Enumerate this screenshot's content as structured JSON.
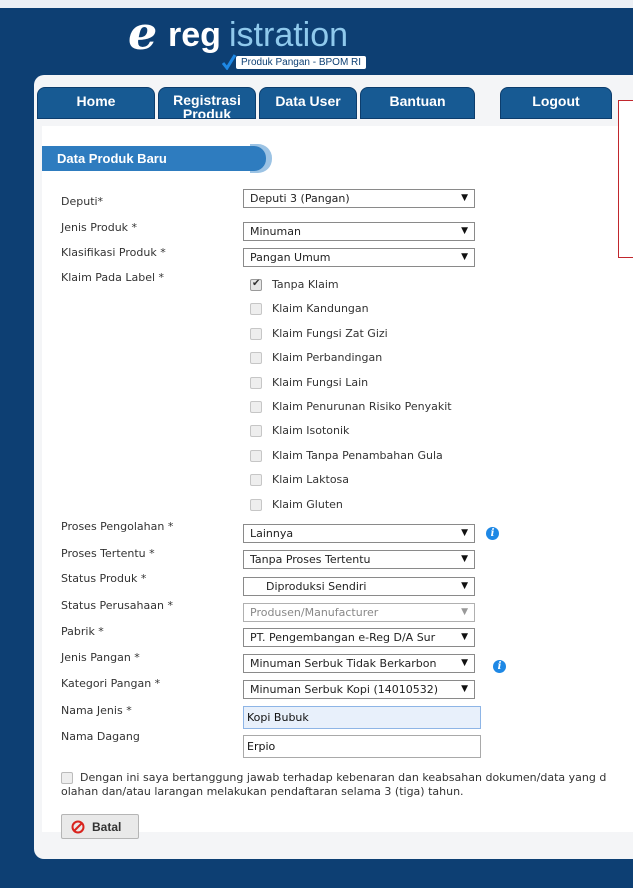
{
  "logo": {
    "e": "e",
    "reg": "reg",
    "istration": "istration",
    "subtitle": "Produk Pangan - BPOM RI"
  },
  "nav": {
    "tabs": [
      "Home",
      "Registrasi Produk",
      "Data User",
      "Bantuan",
      "Logout"
    ]
  },
  "section": {
    "title": "Data Produk Baru"
  },
  "fields": {
    "deputi": {
      "label": "Deputi*",
      "value": "Deputi 3 (Pangan)"
    },
    "jenis_produk": {
      "label": "Jenis Produk *",
      "value": "Minuman"
    },
    "klasifikasi": {
      "label": "Klasifikasi Produk *",
      "value": "Pangan Umum"
    },
    "klaim_label": "Klaim Pada Label *",
    "proses_pengolahan": {
      "label": "Proses Pengolahan *",
      "value": "Lainnya"
    },
    "proses_tertentu": {
      "label": "Proses Tertentu *",
      "value": "Tanpa Proses Tertentu"
    },
    "status_produk": {
      "label": "Status Produk *",
      "value": "Diproduksi Sendiri"
    },
    "status_perusahaan": {
      "label": "Status Perusahaan *",
      "value": "Produsen/Manufacturer"
    },
    "pabrik": {
      "label": "Pabrik *",
      "value": "PT. Pengembangan e-Reg D/A Sur"
    },
    "jenis_pangan": {
      "label": "Jenis Pangan *",
      "value": "Minuman Serbuk Tidak Berkarbon"
    },
    "kategori_pangan": {
      "label": "Kategori Pangan *",
      "value": "Minuman Serbuk Kopi (14010532)"
    },
    "nama_jenis": {
      "label": "Nama Jenis *",
      "value": "Kopi Bubuk"
    },
    "nama_dagang": {
      "label": "Nama Dagang",
      "value": "Erpio"
    }
  },
  "klaim_options": [
    {
      "label": "Tanpa Klaim",
      "checked": true
    },
    {
      "label": "Klaim Kandungan",
      "checked": false
    },
    {
      "label": "Klaim Fungsi Zat Gizi",
      "checked": false
    },
    {
      "label": "Klaim Perbandingan",
      "checked": false
    },
    {
      "label": "Klaim Fungsi Lain",
      "checked": false
    },
    {
      "label": "Klaim Penurunan Risiko Penyakit",
      "checked": false
    },
    {
      "label": "Klaim Isotonik",
      "checked": false
    },
    {
      "label": "Klaim Tanpa Penambahan Gula",
      "checked": false
    },
    {
      "label": "Klaim Laktosa",
      "checked": false
    },
    {
      "label": "Klaim Gluten",
      "checked": false
    }
  ],
  "agreement": {
    "line1": "Dengan ini saya bertanggung jawab terhadap kebenaran dan keabsahan dokumen/data yang d",
    "line2": "olahan dan/atau larangan melakukan pendaftaran selama 3 (tiga) tahun."
  },
  "buttons": {
    "batal": "Batal"
  },
  "icons": {
    "info": "i",
    "info_name": "info-icon",
    "ban_name": "ban-icon",
    "check_name": "checkmark-icon"
  },
  "colors": {
    "background": "#0d3f73",
    "tab": "#175a93",
    "section_title": "#2e7cbf",
    "info_icon": "#1e88e5",
    "alert_border": "#c1272d",
    "ban_icon": "#d9231d"
  }
}
